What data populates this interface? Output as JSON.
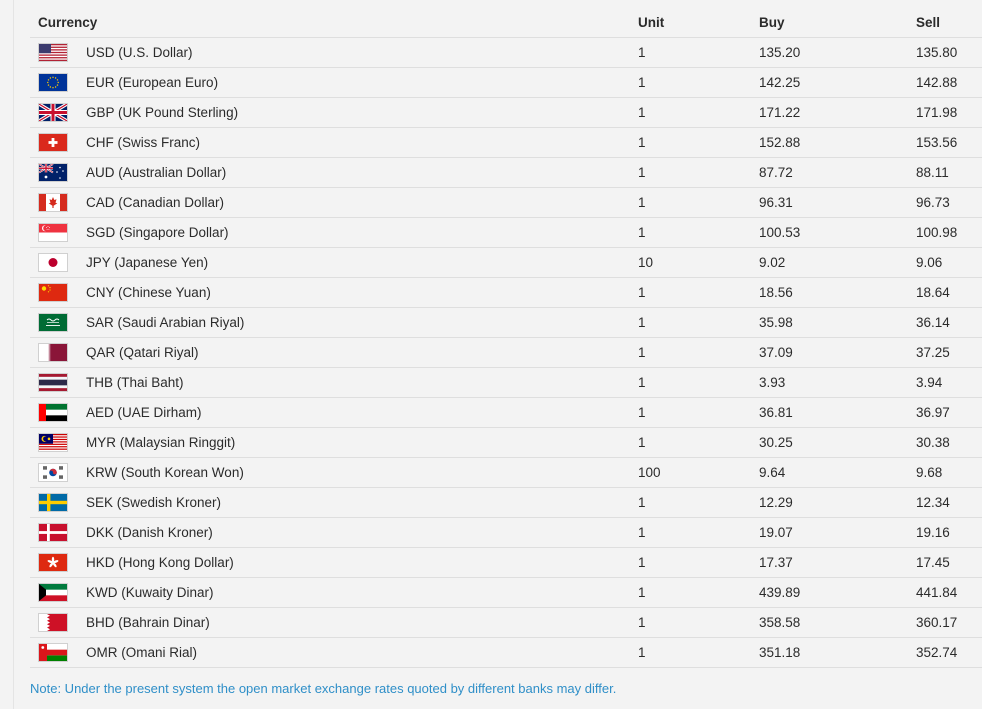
{
  "table": {
    "headers": {
      "currency": "Currency",
      "unit": "Unit",
      "buy": "Buy",
      "sell": "Sell"
    },
    "rows": [
      {
        "flag": "us-flag-icon",
        "currency": "USD (U.S. Dollar)",
        "unit": "1",
        "buy": "135.20",
        "sell": "135.80"
      },
      {
        "flag": "eu-flag-icon",
        "currency": "EUR (European Euro)",
        "unit": "1",
        "buy": "142.25",
        "sell": "142.88"
      },
      {
        "flag": "uk-flag-icon",
        "currency": "GBP (UK Pound Sterling)",
        "unit": "1",
        "buy": "171.22",
        "sell": "171.98"
      },
      {
        "flag": "ch-flag-icon",
        "currency": "CHF (Swiss Franc)",
        "unit": "1",
        "buy": "152.88",
        "sell": "153.56"
      },
      {
        "flag": "au-flag-icon",
        "currency": "AUD (Australian Dollar)",
        "unit": "1",
        "buy": "87.72",
        "sell": "88.11"
      },
      {
        "flag": "ca-flag-icon",
        "currency": "CAD (Canadian Dollar)",
        "unit": "1",
        "buy": "96.31",
        "sell": "96.73"
      },
      {
        "flag": "sg-flag-icon",
        "currency": "SGD (Singapore Dollar)",
        "unit": "1",
        "buy": "100.53",
        "sell": "100.98"
      },
      {
        "flag": "jp-flag-icon",
        "currency": "JPY (Japanese Yen)",
        "unit": "10",
        "buy": "9.02",
        "sell": "9.06"
      },
      {
        "flag": "cn-flag-icon",
        "currency": "CNY (Chinese Yuan)",
        "unit": "1",
        "buy": "18.56",
        "sell": "18.64"
      },
      {
        "flag": "sa-flag-icon",
        "currency": "SAR (Saudi Arabian Riyal)",
        "unit": "1",
        "buy": "35.98",
        "sell": "36.14"
      },
      {
        "flag": "qa-flag-icon",
        "currency": "QAR (Qatari Riyal)",
        "unit": "1",
        "buy": "37.09",
        "sell": "37.25"
      },
      {
        "flag": "th-flag-icon",
        "currency": "THB (Thai Baht)",
        "unit": "1",
        "buy": "3.93",
        "sell": "3.94"
      },
      {
        "flag": "ae-flag-icon",
        "currency": "AED (UAE Dirham)",
        "unit": "1",
        "buy": "36.81",
        "sell": "36.97"
      },
      {
        "flag": "my-flag-icon",
        "currency": "MYR (Malaysian Ringgit)",
        "unit": "1",
        "buy": "30.25",
        "sell": "30.38"
      },
      {
        "flag": "kr-flag-icon",
        "currency": "KRW (South Korean Won)",
        "unit": "100",
        "buy": "9.64",
        "sell": "9.68"
      },
      {
        "flag": "se-flag-icon",
        "currency": "SEK (Swedish Kroner)",
        "unit": "1",
        "buy": "12.29",
        "sell": "12.34"
      },
      {
        "flag": "dk-flag-icon",
        "currency": "DKK (Danish Kroner)",
        "unit": "1",
        "buy": "19.07",
        "sell": "19.16"
      },
      {
        "flag": "hk-flag-icon",
        "currency": "HKD (Hong Kong Dollar)",
        "unit": "1",
        "buy": "17.37",
        "sell": "17.45"
      },
      {
        "flag": "kw-flag-icon",
        "currency": "KWD (Kuwaity Dinar)",
        "unit": "1",
        "buy": "439.89",
        "sell": "441.84"
      },
      {
        "flag": "bh-flag-icon",
        "currency": "BHD (Bahrain Dinar)",
        "unit": "1",
        "buy": "358.58",
        "sell": "360.17"
      },
      {
        "flag": "om-flag-icon",
        "currency": "OMR (Omani Rial)",
        "unit": "1",
        "buy": "351.18",
        "sell": "352.74"
      }
    ]
  },
  "note": "Note: Under the present system the open market exchange rates quoted by different banks may differ.",
  "colors": {
    "note_text": "#2f8fc8",
    "row_divider": "#dedede",
    "background": "#f3f3f3"
  }
}
